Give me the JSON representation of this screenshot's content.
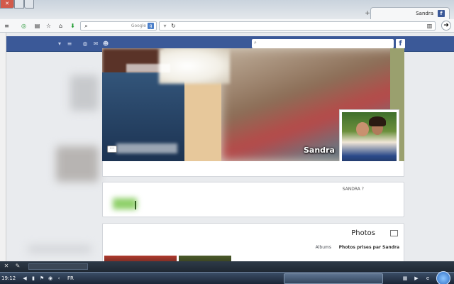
{
  "browser": {
    "tab_title": "Sandra",
    "tab_favicon": "f",
    "search_placeholder": "Google",
    "new_tab_symbol": "+",
    "back_symbol": "➜"
  },
  "facebook": {
    "logo": "f",
    "brand_color": "#3b5998"
  },
  "cover": {
    "more_symbol": "···",
    "profile_name": "Sandra"
  },
  "intro": {
    "title": "SANDRA ?"
  },
  "photos": {
    "title": "Photos",
    "tabs": [
      "Photos prises par Sandra",
      "Albums"
    ]
  },
  "taskbar": {
    "clock": "19:12",
    "language": "FR"
  }
}
